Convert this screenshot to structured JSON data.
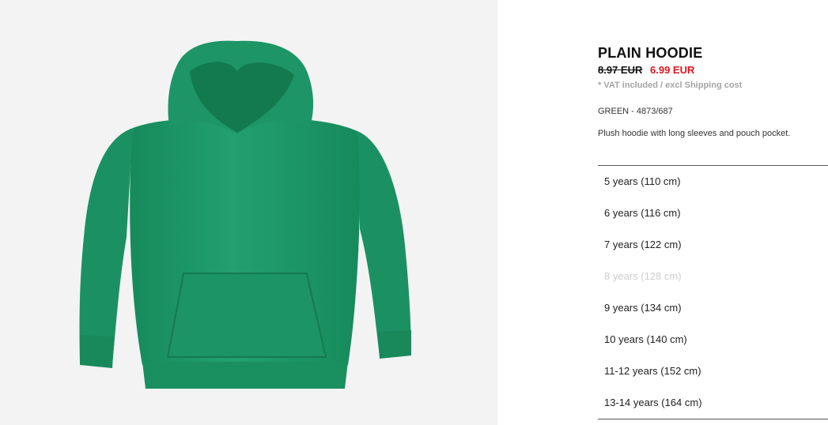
{
  "product": {
    "title": "PLAIN HOODIE",
    "price_old": "8.97 EUR",
    "price_new": "6.99 EUR",
    "vat_note": "* VAT included / excl Shipping cost",
    "color_ref": "GREEN - 4873/687",
    "description": "Plush hoodie with long sleeves and pouch pocket.",
    "image_color": "#1f9a68",
    "price_new_color": "#e0151c"
  },
  "sizes": [
    {
      "label": "5 years (110 cm)",
      "available": true
    },
    {
      "label": "6 years (116 cm)",
      "available": true
    },
    {
      "label": "7 years (122 cm)",
      "available": true
    },
    {
      "label": "8 years (128 cm)",
      "available": false
    },
    {
      "label": "9 years (134 cm)",
      "available": true
    },
    {
      "label": "10 years (140 cm)",
      "available": true
    },
    {
      "label": "11-12 years (152 cm)",
      "available": true
    },
    {
      "label": "13-14 years (164 cm)",
      "available": true
    }
  ]
}
